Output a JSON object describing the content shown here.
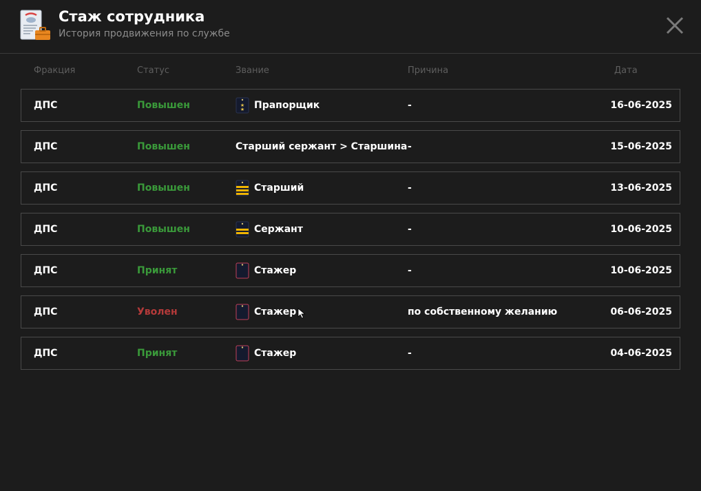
{
  "header": {
    "title": "Стаж сотрудника",
    "subtitle": "История продвижения по службе",
    "app_icon": "document-briefcase-icon",
    "close_icon": "close-icon"
  },
  "columns": {
    "faction": "Фракция",
    "status": "Статус",
    "rank": "Звание",
    "reason": "Причина",
    "date": "Дата"
  },
  "colors": {
    "promoted": "#3a9a3a",
    "fired": "#b53a3a",
    "background": "#1c1c1c"
  },
  "rows": [
    {
      "faction": "ДПС",
      "status": "Повышен",
      "status_type": "green",
      "rank": "Прапорщик",
      "rank_icon": "ensign-badge-icon",
      "reason": "-",
      "date": "16-06-2025"
    },
    {
      "faction": "ДПС",
      "status": "Повышен",
      "status_type": "green",
      "rank": "Старший сержант > Старшина",
      "rank_icon": "",
      "reason": "-",
      "date": "15-06-2025"
    },
    {
      "faction": "ДПС",
      "status": "Повышен",
      "status_type": "green",
      "rank": "Старший",
      "rank_icon": "senior-stripes-badge-icon",
      "reason": "-",
      "date": "13-06-2025"
    },
    {
      "faction": "ДПС",
      "status": "Повышен",
      "status_type": "green",
      "rank": "Сержант",
      "rank_icon": "sergeant-stripes-badge-icon",
      "reason": "-",
      "date": "10-06-2025"
    },
    {
      "faction": "ДПС",
      "status": "Принят",
      "status_type": "green",
      "rank": "Стажер",
      "rank_icon": "trainee-badge-icon",
      "reason": "-",
      "date": "10-06-2025"
    },
    {
      "faction": "ДПС",
      "status": "Уволен",
      "status_type": "red",
      "rank": "Стажер",
      "rank_icon": "trainee-badge-icon",
      "reason": "по собственному желанию",
      "date": "06-06-2025"
    },
    {
      "faction": "ДПС",
      "status": "Принят",
      "status_type": "green",
      "rank": "Стажер",
      "rank_icon": "trainee-badge-icon",
      "reason": "-",
      "date": "04-06-2025"
    }
  ]
}
